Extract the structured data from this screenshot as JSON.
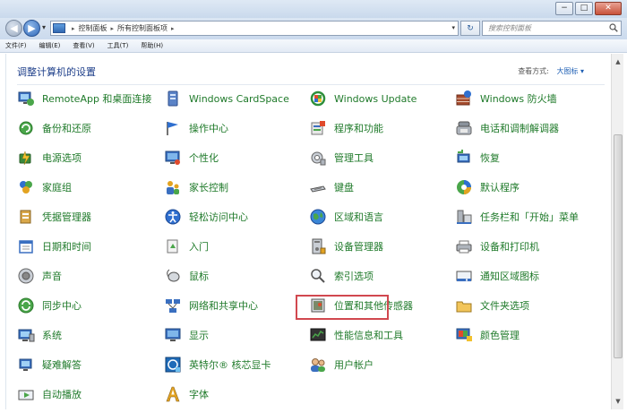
{
  "window": {
    "minimize": "−",
    "maximize": "□",
    "close": "✕"
  },
  "address": {
    "crumbs": [
      "控制面板",
      "所有控制面板项"
    ],
    "dropdown": "▾",
    "refresh": "↻",
    "search_placeholder": "搜索控制面板"
  },
  "menu": [
    "文件(F)",
    "编辑(E)",
    "查看(V)",
    "工具(T)",
    "帮助(H)"
  ],
  "content": {
    "title": "调整计算机的设置",
    "view_label": "查看方式:",
    "view_value": "大图标 ▾"
  },
  "items": [
    [
      "RemoteApp 和桌面连接",
      "Windows CardSpace",
      "Windows Update",
      "Windows 防火墙"
    ],
    [
      "备份和还原",
      "操作中心",
      "程序和功能",
      "电话和调制解调器"
    ],
    [
      "电源选项",
      "个性化",
      "管理工具",
      "恢复"
    ],
    [
      "家庭组",
      "家长控制",
      "键盘",
      "默认程序"
    ],
    [
      "凭据管理器",
      "轻松访问中心",
      "区域和语言",
      "任务栏和「开始」菜单"
    ],
    [
      "日期和时间",
      "入门",
      "设备管理器",
      "设备和打印机"
    ],
    [
      "声音",
      "鼠标",
      "索引选项",
      "通知区域图标"
    ],
    [
      "同步中心",
      "网络和共享中心",
      "位置和其他传感器",
      "文件夹选项"
    ],
    [
      "系统",
      "显示",
      "性能信息和工具",
      "颜色管理"
    ],
    [
      "疑难解答",
      "英特尔® 核芯显卡",
      "用户帐户"
    ],
    [
      "自动播放",
      "字体"
    ]
  ],
  "colors": {
    "label_green": "#1f7a2a",
    "title_blue": "#1e3f8a",
    "highlight_red": "#d1484f"
  }
}
